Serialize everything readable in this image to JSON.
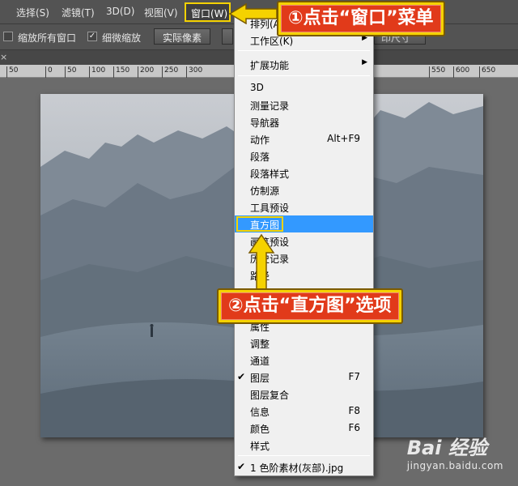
{
  "menubar": {
    "items": [
      {
        "label": "选择(S)"
      },
      {
        "label": "滤镜(T)"
      },
      {
        "label": "3D(D)"
      },
      {
        "label": "视图(V)"
      },
      {
        "label": "窗口(W)"
      }
    ]
  },
  "options_bar": {
    "zoom_all_label": "缩放所有窗口",
    "scrubby_label": "细微缩放",
    "actual_pixels": "实际像素",
    "right_btn_fragment": "印尺寸"
  },
  "ruler": {
    "ticks": [
      "50",
      "0",
      "50",
      "100",
      "150",
      "200",
      "250",
      "300",
      "",
      "",
      "",
      "550",
      "600",
      "650"
    ]
  },
  "window_menu": {
    "items": [
      {
        "label": "排列(A)",
        "submenu": true
      },
      {
        "label": "工作区(K)",
        "submenu": true
      },
      {
        "separator": true
      },
      {
        "label": "扩展功能",
        "submenu": true
      },
      {
        "separator": true
      },
      {
        "label": "3D"
      },
      {
        "label": "测量记录"
      },
      {
        "label": "导航器"
      },
      {
        "label": "动作",
        "shortcut": "Alt+F9"
      },
      {
        "label": "段落"
      },
      {
        "label": "段落样式"
      },
      {
        "label": "仿制源"
      },
      {
        "label": "工具预设"
      },
      {
        "label": "直方图",
        "highlighted": true
      },
      {
        "label": "画笔预设"
      },
      {
        "label": "历史记录"
      },
      {
        "label": "路径"
      },
      {
        "label": ""
      },
      {
        "label": ""
      },
      {
        "label": "属性"
      },
      {
        "label": "调整"
      },
      {
        "label": "通道"
      },
      {
        "label": "图层",
        "shortcut": "F7",
        "checked": true
      },
      {
        "label": "图层复合"
      },
      {
        "label": "信息",
        "shortcut": "F8"
      },
      {
        "label": "颜色",
        "shortcut": "F6"
      },
      {
        "label": "样式"
      },
      {
        "separator": true
      },
      {
        "label": "1 色阶素材(灰部).jpg",
        "checked": true
      }
    ]
  },
  "callouts": {
    "step1": "①点击“窗口”菜单",
    "step2": "②点击“直方图”选项"
  },
  "watermark": {
    "brand": "Bai 经验",
    "url": "jingyan.baidu.com"
  },
  "colors": {
    "callout_yellow": "#f5d200",
    "callout_red": "#e13a1a",
    "menu_highlight": "#3399ff"
  }
}
